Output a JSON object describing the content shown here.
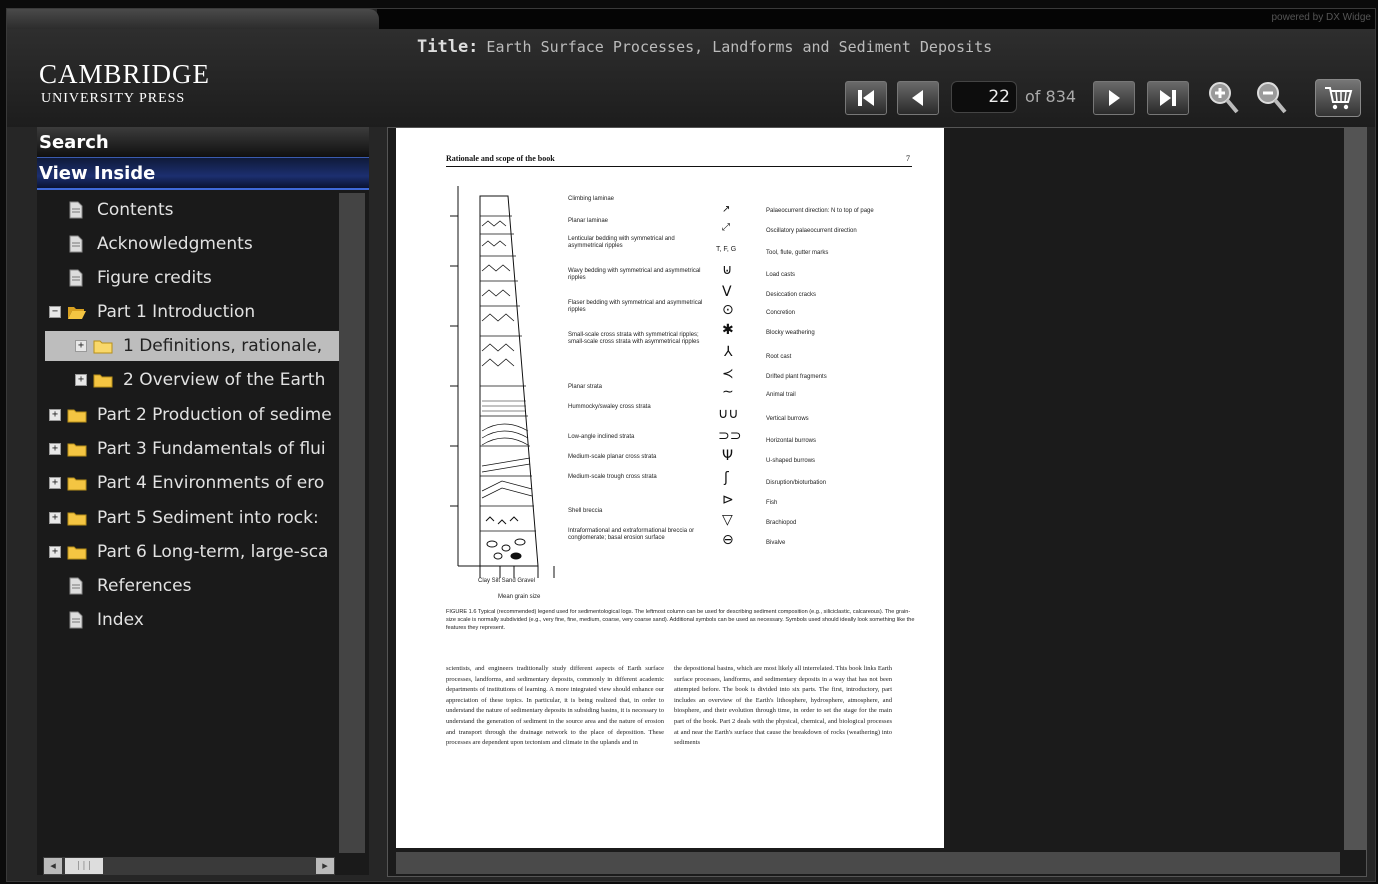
{
  "powered_by": "powered by DX Widge",
  "logo": {
    "main": "CAMBRIDGE",
    "sub": "UNIVERSITY PRESS"
  },
  "title": {
    "label": "Title:",
    "value": "Earth Surface Processes, Landforms and Sediment Deposits"
  },
  "pager": {
    "current": "22",
    "of_total": "of 834"
  },
  "tabs": {
    "search": "Search",
    "view_inside": "View Inside"
  },
  "toc": [
    {
      "label": "Contents"
    },
    {
      "label": "Acknowledgments"
    },
    {
      "label": "Figure credits"
    },
    {
      "label": "Part 1 Introduction"
    },
    {
      "label": "1 Definitions, rationale,"
    },
    {
      "label": "2 Overview of the Earth"
    },
    {
      "label": "Part 2 Production of sedime"
    },
    {
      "label": "Part 3 Fundamentals of flui"
    },
    {
      "label": "Part 4 Environments of ero"
    },
    {
      "label": "Part 5 Sediment into rock:"
    },
    {
      "label": "Part 6 Long-term, large-sca"
    },
    {
      "label": "References"
    },
    {
      "label": "Index"
    }
  ],
  "page": {
    "running_head": "Rationale and scope of the book",
    "page_number": "7",
    "legend_left": [
      "Climbing laminae",
      "Planar laminae",
      "Lenticular bedding with symmetrical and asymmetrical ripples",
      "Wavy bedding with symmetrical and asymmetrical ripples",
      "Flaser bedding with symmetrical and asymmetrical ripples",
      "Small-scale cross strata with symmetrical ripples; small-scale cross strata with asymmetrical ripples",
      "Planar strata",
      "Hummocky/swaley cross strata",
      "Low-angle inclined strata",
      "Medium-scale planar cross strata",
      "Medium-scale trough cross strata",
      "Shell breccia",
      "Intraformational and extraformational breccia or conglomerate; basal erosion surface"
    ],
    "legend_right": [
      "Palaeocurrent direction: N to top of page",
      "Oscillatory palaeocurrent direction",
      "Tool, flute, gutter marks",
      "Load casts",
      "Desiccation cracks",
      "Concretion",
      "Blocky weathering",
      "Root cast",
      "Drifted plant fragments",
      "Animal trail",
      "Vertical burrows",
      "Horizontal burrows",
      "U-shaped burrows",
      "Disruption/bioturbation",
      "Fish",
      "Brachiopod",
      "Bivalve"
    ],
    "tool_marks": "T, F, G",
    "grain_labels": "Clay  Silt  Sand Gravel",
    "grain_size_label": "Mean grain size",
    "caption": "FIGURE 1.6 Typical (recommended) legend used for sedimentological logs. The leftmost column can be used for describing sediment composition (e.g., siliciclastic, calcareous). The grain-size scale is normally subdivided (e.g., very fine, fine, medium, coarse, very coarse sand). Additional symbols can be used as necessary. Symbols used should ideally look something like the features they represent.",
    "body_left": "scientists, and engineers traditionally study different aspects of Earth surface processes, landforms, and sedimentary deposits, commonly in different academic departments of institutions of learning. A more integrated view should enhance our appreciation of these topics. In particular, it is being realized that, in order to understand the nature of sedimentary deposits in subsiding basins, it is necessary to understand the generation of sediment in the source area and the nature of erosion and transport through the drainage network to the place of deposition. These processes are dependent upon tectonism and climate in the uplands and in",
    "body_right": "the depositional basins, which are most likely all interrelated. This book links Earth surface processes, landforms, and sedimentary deposits in a way that has not been attempted before. The book is divided into six parts. The first, introductory, part includes an overview of the Earth's lithosphere, hydrosphere, atmosphere, and biosphere, and their evolution through time, in order to set the stage for the main part of the book. Part 2 deals with the physical, chemical, and biological processes at and near the Earth's surface that cause the breakdown of rocks (weathering) into sediments"
  }
}
